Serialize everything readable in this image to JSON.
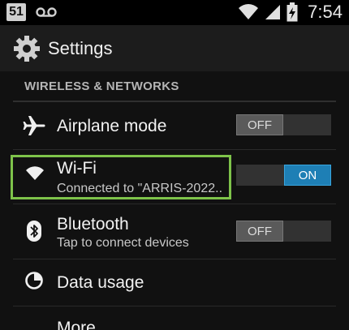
{
  "status_bar": {
    "notification_count": "51",
    "voicemail_icon": "voicemail-icon",
    "wifi_icon": "wifi-icon",
    "signal_icon": "signal-icon",
    "battery_icon": "battery-charging-icon",
    "time": "7:54"
  },
  "action_bar": {
    "icon": "gear-icon",
    "title": "Settings"
  },
  "section": {
    "title": "WIRELESS & NETWORKS"
  },
  "items": [
    {
      "icon": "airplane-icon",
      "label": "Airplane mode",
      "toggle": "OFF"
    },
    {
      "icon": "wifi-icon",
      "label": "Wi-Fi",
      "subtitle": "Connected to \"ARRIS-2022..",
      "toggle": "ON"
    },
    {
      "icon": "bluetooth-icon",
      "label": "Bluetooth",
      "subtitle": "Tap to connect devices",
      "toggle": "OFF"
    },
    {
      "icon": "data-usage-icon",
      "label": "Data usage"
    },
    {
      "icon": "more-icon",
      "label": "More..."
    }
  ],
  "colors": {
    "toggle_on": "#1e7fb5",
    "highlight": "#7ec34a"
  }
}
